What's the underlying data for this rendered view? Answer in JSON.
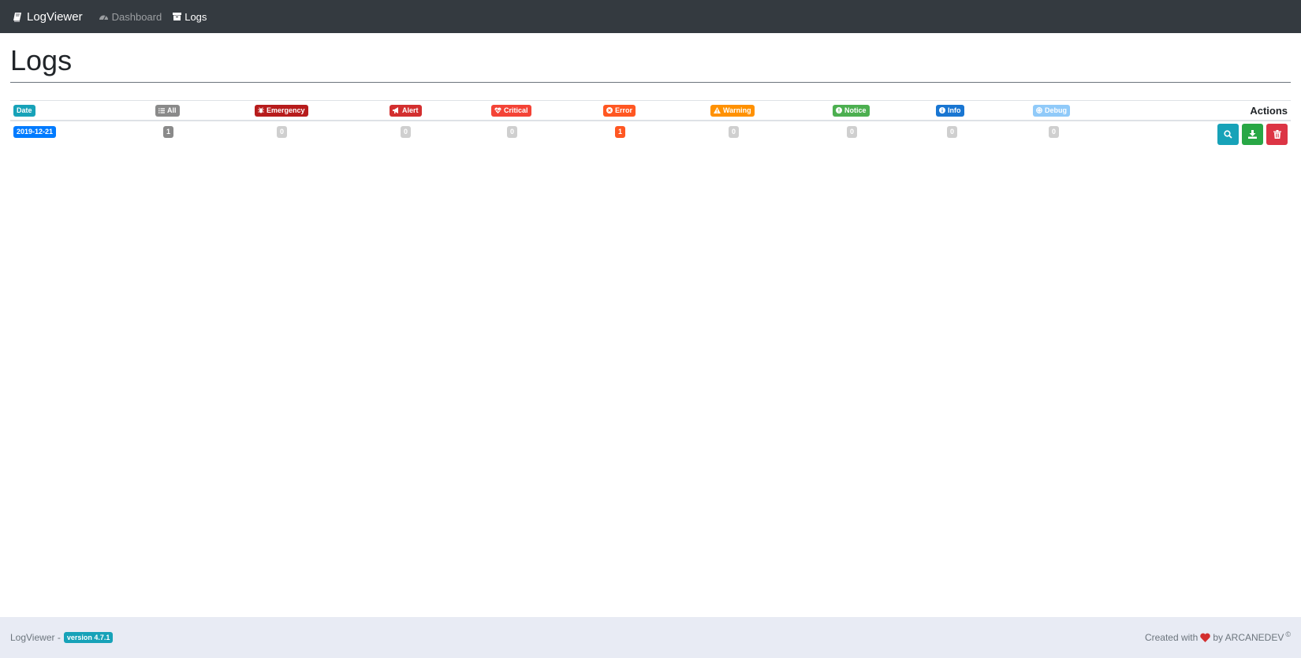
{
  "navbar": {
    "brand": "LogViewer",
    "links": [
      {
        "label": "Dashboard",
        "active": false
      },
      {
        "label": "Logs",
        "active": true
      }
    ]
  },
  "page": {
    "title": "Logs"
  },
  "table": {
    "headers": {
      "date": {
        "label": "Date",
        "color": "#17a2b8"
      },
      "all": {
        "label": "All",
        "color": "#8a8a8a",
        "icon": "list-icon"
      },
      "emergency": {
        "label": "Emergency",
        "color": "#b71c1c",
        "icon": "bug-icon"
      },
      "alert": {
        "label": "Alert",
        "color": "#d32f2f",
        "icon": "bullhorn-icon"
      },
      "critical": {
        "label": "Critical",
        "color": "#f44336",
        "icon": "heartbeat-icon"
      },
      "error": {
        "label": "Error",
        "color": "#ff5722",
        "icon": "times-circle-icon"
      },
      "warning": {
        "label": "Warning",
        "color": "#ff9100",
        "icon": "warning-icon"
      },
      "notice": {
        "label": "Notice",
        "color": "#4caf50",
        "icon": "exclamation-circle-icon"
      },
      "info": {
        "label": "Info",
        "color": "#1976d2",
        "icon": "info-circle-icon"
      },
      "debug": {
        "label": "Debug",
        "color": "#90caf9",
        "icon": "life-ring-icon"
      },
      "actions": {
        "label": "Actions"
      }
    },
    "rows": [
      {
        "date": "2019-12-21",
        "date_color": "#007bff",
        "all": "1",
        "emergency": "0",
        "alert": "0",
        "critical": "0",
        "error": "1",
        "warning": "0",
        "notice": "0",
        "info": "0",
        "debug": "0"
      }
    ]
  },
  "footer": {
    "left_text": "LogViewer -",
    "version": "version 4.7.1",
    "created_text": "Created with",
    "by_text": "by ARCANEDEV",
    "copyright": "©"
  }
}
